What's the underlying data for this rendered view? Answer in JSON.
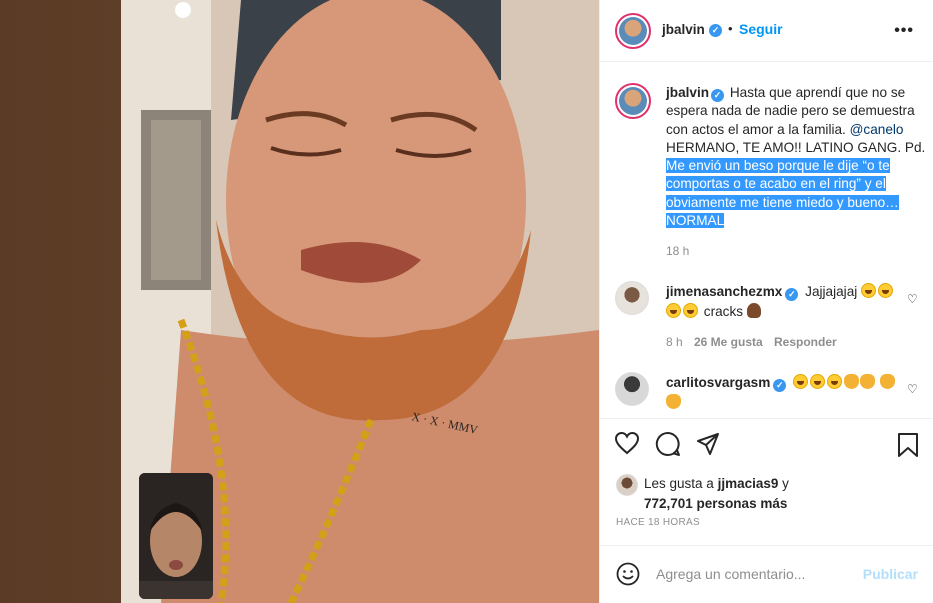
{
  "post": {
    "author": "jbalvin",
    "follow_label": "Seguir",
    "more_label": "•••",
    "dot": "•"
  },
  "caption": {
    "author": "jbalvin",
    "text_plain": "Hasta que aprendí que no se espera nada de nadie pero se demuestra con actos el amor a la familia.",
    "mention": "@canelo",
    "text_after_mention": "HERMANO, TE AMO!! LATINO GANG. Pd.",
    "text_selected": "Me envió un beso porque le dije “o te comportas o te acabo en el ring” y el obviamente me tiene miedo y bueno… NORMAL",
    "time": "18 h"
  },
  "comments": [
    {
      "author": "jimenasanchezmx",
      "text_before": "Jajjajajaj",
      "text_after": "cracks",
      "time": "8 h",
      "likes": "26 Me gusta",
      "reply_label": "Responder"
    },
    {
      "author": "carlitosvargasm"
    }
  ],
  "likes": {
    "prefix": "Les gusta a",
    "first_user": "jjmacias9",
    "connector": "y",
    "count_text": "772,701 personas más"
  },
  "timestamp": "HACE 18 HORAS",
  "comment_box": {
    "placeholder": "Agrega un comentario...",
    "publish_label": "Publicar"
  },
  "colors": {
    "accent": "#0095f6",
    "verified": "#3897f0",
    "selection": "#3399ff",
    "muted": "#8e8e8e"
  },
  "icons": [
    "verified-badge-icon",
    "more-icon",
    "heart-icon",
    "comment-icon",
    "share-icon",
    "bookmark-icon",
    "emoji-icon"
  ]
}
